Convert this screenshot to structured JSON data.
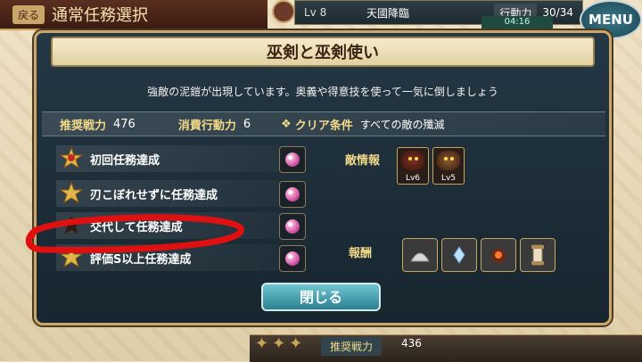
{
  "hud": {
    "back_label": "戻る",
    "title": "通常任務選択",
    "level_label": "Lv",
    "level": "8",
    "player_name": "天國降臨",
    "ap_label": "行動力",
    "ap": "30/34",
    "timer": "04:16",
    "menu_label": "MENU"
  },
  "dialog": {
    "title": "巫剣と巫剣使い",
    "description": "強敵の泥鎧が出現しています。奥義や得意技を使って一気に倒しましょう",
    "recommended_power_label": "推奨戦力",
    "recommended_power": "476",
    "ap_cost_label": "消費行動力",
    "ap_cost": "6",
    "clear_condition_label": "クリア条件",
    "clear_condition": "すべての敵の殲滅",
    "missions": [
      {
        "label": "初回任務達成",
        "achieved": true
      },
      {
        "label": "刃こぼれせずに任務達成",
        "achieved": true
      },
      {
        "label": "交代して任務達成",
        "achieved": false
      },
      {
        "label": "評価S以上任務達成",
        "achieved": true
      }
    ],
    "enemy_info_label": "敵情報",
    "enemies": [
      {
        "level": "Lv6"
      },
      {
        "level": "Lv5"
      }
    ],
    "rewards_label": "報酬",
    "rewards": [
      "shell-icon",
      "crystal-shard-icon",
      "fire-stone-icon",
      "scroll-icon"
    ],
    "close_label": "閉じる"
  },
  "bottom": {
    "recommended_power_label": "推奨戦力",
    "recommended_power": "436"
  },
  "colors": {
    "accent_gold": "#caa66a",
    "dialog_bg": "#1d2d37",
    "close_button": "#3d9fb0",
    "marker_red": "#e01010"
  }
}
